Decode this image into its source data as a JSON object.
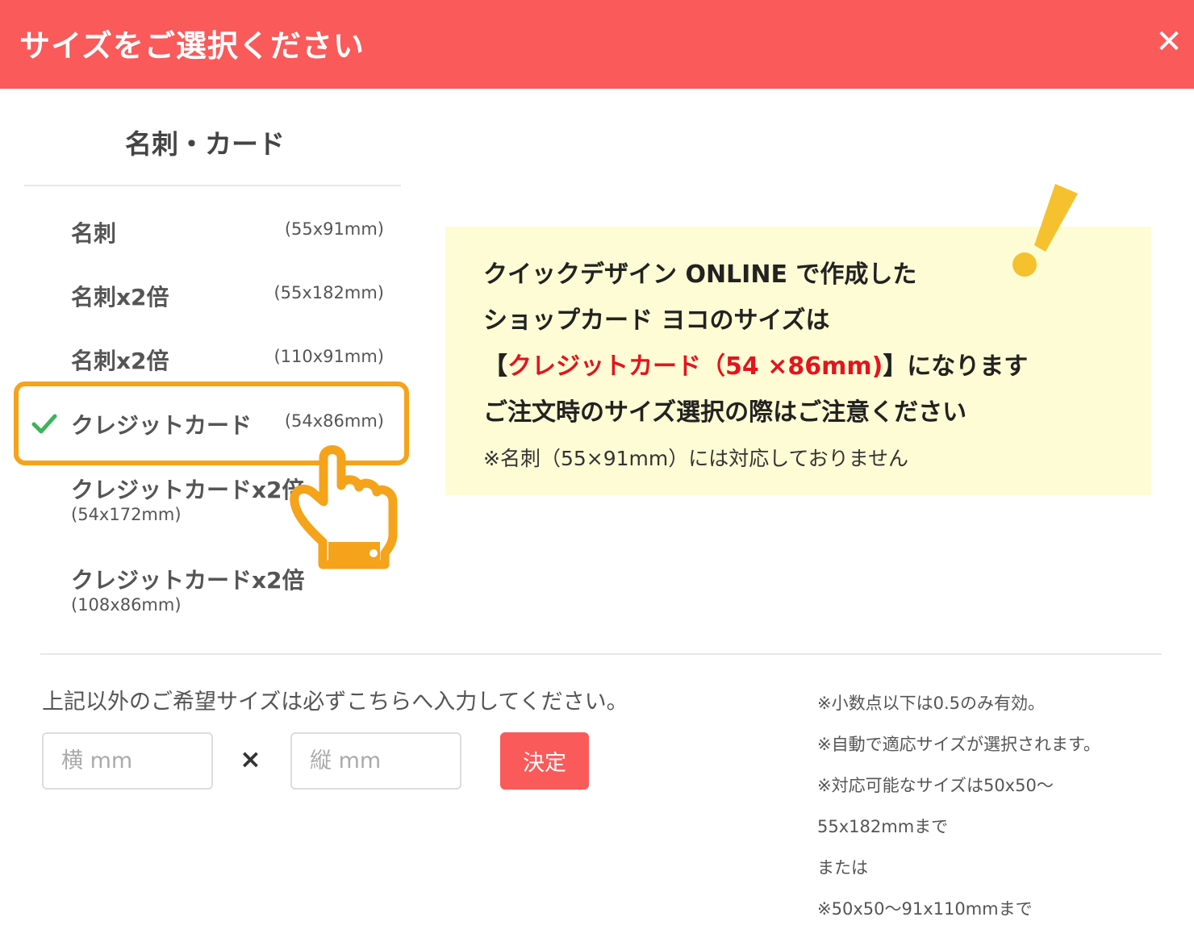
{
  "header": {
    "title": "サイズをご選択ください",
    "close_label": "✕"
  },
  "category": {
    "title": "名刺・カード"
  },
  "sizes": [
    {
      "name": "名刺",
      "dim": "(55x91mm)"
    },
    {
      "name": "名刺x2倍",
      "dim": "(55x182mm)"
    },
    {
      "name": "名刺x2倍",
      "dim": "(110x91mm)"
    },
    {
      "name": "クレジットカード",
      "dim": "(54x86mm)",
      "selected": true
    },
    {
      "name": "クレジットカードx2倍",
      "dim": "(54x172mm)"
    },
    {
      "name": "クレジットカードx2倍",
      "dim": "(108x86mm)"
    }
  ],
  "notice": {
    "line1": "クイックデザイン ONLINE で作成した",
    "line2": "ショップカード ヨコのサイズは",
    "line3_open": "【",
    "line3_red": "クレジットカード（54 ×86mm)",
    "line3_close": "】になります",
    "line4": "ご注文時のサイズ選択の際はご注意ください",
    "line5": "※名刺（55×91mm）には対応しておりません"
  },
  "custom": {
    "label": "上記以外のご希望サイズは必ずこちらへ入力してください。",
    "width_placeholder": "横 mm",
    "height_placeholder": "縦 mm",
    "times": "×",
    "submit_label": "決定"
  },
  "notes": [
    "※小数点以下は0.5のみ有効。",
    "※自動で適応サイズが選択されます。",
    "※対応可能なサイズは50x50〜",
    "55x182mmまで",
    "または",
    "※50x50〜91x110mmまで"
  ],
  "colors": {
    "header": "#fa5a5a",
    "highlight": "#f5a31a",
    "check": "#3cb45a",
    "notice_bg": "#fefcd4",
    "notice_red": "#e4141e"
  }
}
